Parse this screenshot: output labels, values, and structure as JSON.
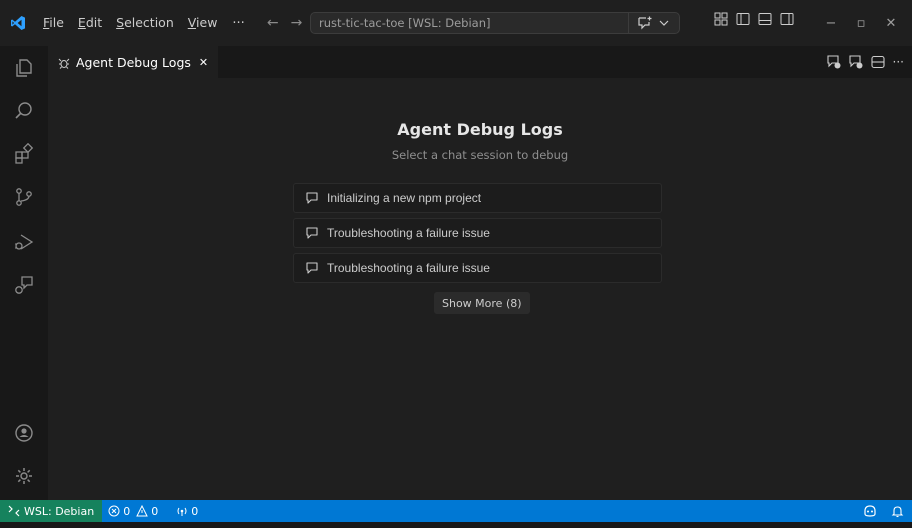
{
  "menu": {
    "file": {
      "mn": "F",
      "rest": "ile"
    },
    "edit": {
      "mn": "E",
      "rest": "dit"
    },
    "selection": {
      "mn": "S",
      "rest": "election"
    },
    "view": {
      "mn": "V",
      "rest": "iew"
    },
    "more": "···"
  },
  "command_center": {
    "text": "rust-tic-tac-toe [WSL: Debian]"
  },
  "tab": {
    "label": "Agent Debug Logs",
    "close": "✕"
  },
  "panel": {
    "title": "Agent Debug Logs",
    "subtitle": "Select a chat session to debug",
    "sessions": [
      {
        "label": "Initializing a new npm project"
      },
      {
        "label": "Troubleshooting a failure issue"
      },
      {
        "label": "Troubleshooting a failure issue"
      }
    ],
    "show_more": "Show More (8)"
  },
  "statusbar": {
    "remote": "WSL: Debian",
    "errors": "0",
    "warnings": "0",
    "ports": "0"
  },
  "colors": {
    "accent": "#0078d4",
    "remote": "#16825d",
    "logo": "#2ea0ff"
  }
}
